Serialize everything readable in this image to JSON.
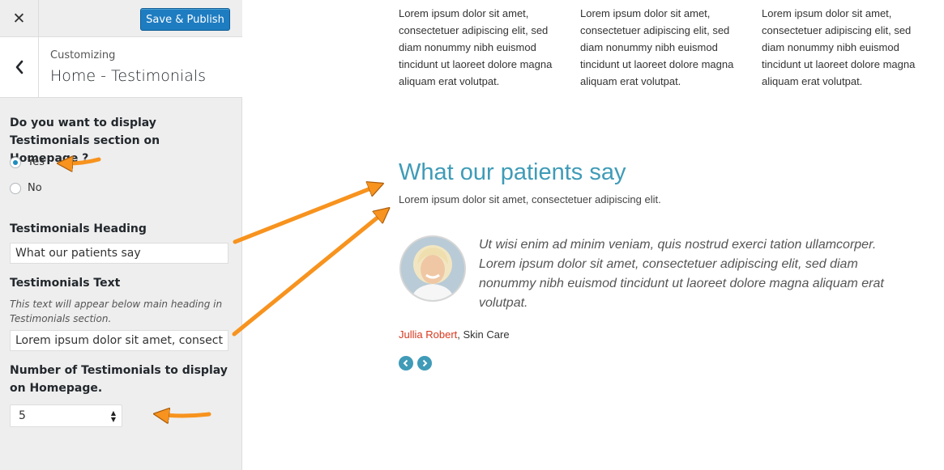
{
  "toolbar": {
    "close_glyph": "✕",
    "publish_label": "Save & Publish",
    "publish_color": "#1e7cc1"
  },
  "section": {
    "subtitle": "Customizing",
    "title": "Home - Testimonials",
    "back_icon": "chevron-left-icon"
  },
  "controls": {
    "display_label": "Do you want to display Testimonials section on Homepage ?",
    "display_options": [
      {
        "label": "Yes",
        "selected": true
      },
      {
        "label": "No",
        "selected": false
      }
    ],
    "heading_label": "Testimonials Heading",
    "heading_value": "What our patients say",
    "text_label": "Testimonials Text",
    "text_description": "This text will appear below main heading in Testimonials section.",
    "text_value": "Lorem ipsum dolor sit amet, consectetuer adipiscing elit.",
    "number_label": "Number of Testimonials to display on Homepage.",
    "number_value": "5"
  },
  "preview": {
    "lorem_columns": [
      "Lorem ipsum dolor sit amet, consectetuer adipiscing elit, sed diam nonummy nibh euismod tincidunt ut laoreet dolore magna aliquam erat volutpat.",
      "Lorem ipsum dolor sit amet, consectetuer adipiscing elit, sed diam nonummy nibh euismod tincidunt ut laoreet dolore magna aliquam erat volutpat.",
      "Lorem ipsum dolor sit amet, consectetuer adipiscing elit, sed diam nonummy nibh euismod tincidunt ut laoreet dolore magna aliquam erat volutpat."
    ],
    "heading": "What our patients say",
    "subtext": "Lorem ipsum dolor sit amet, consectetuer adipiscing elit.",
    "quote": "Ut wisi enim ad minim veniam, quis nostrud exerci tation ullamcorper. Lorem ipsum dolor sit amet, consectetuer adipiscing elit, sed diam nonummy nibh euismod tincidunt ut laoreet dolore magna aliquam erat volutpat.",
    "author_name": "Jullia Robert",
    "author_separator": ", ",
    "author_role": "Skin Care",
    "heading_color": "#3f9bb7",
    "author_color": "#d9381e"
  },
  "annotation_color": "#f7931e"
}
